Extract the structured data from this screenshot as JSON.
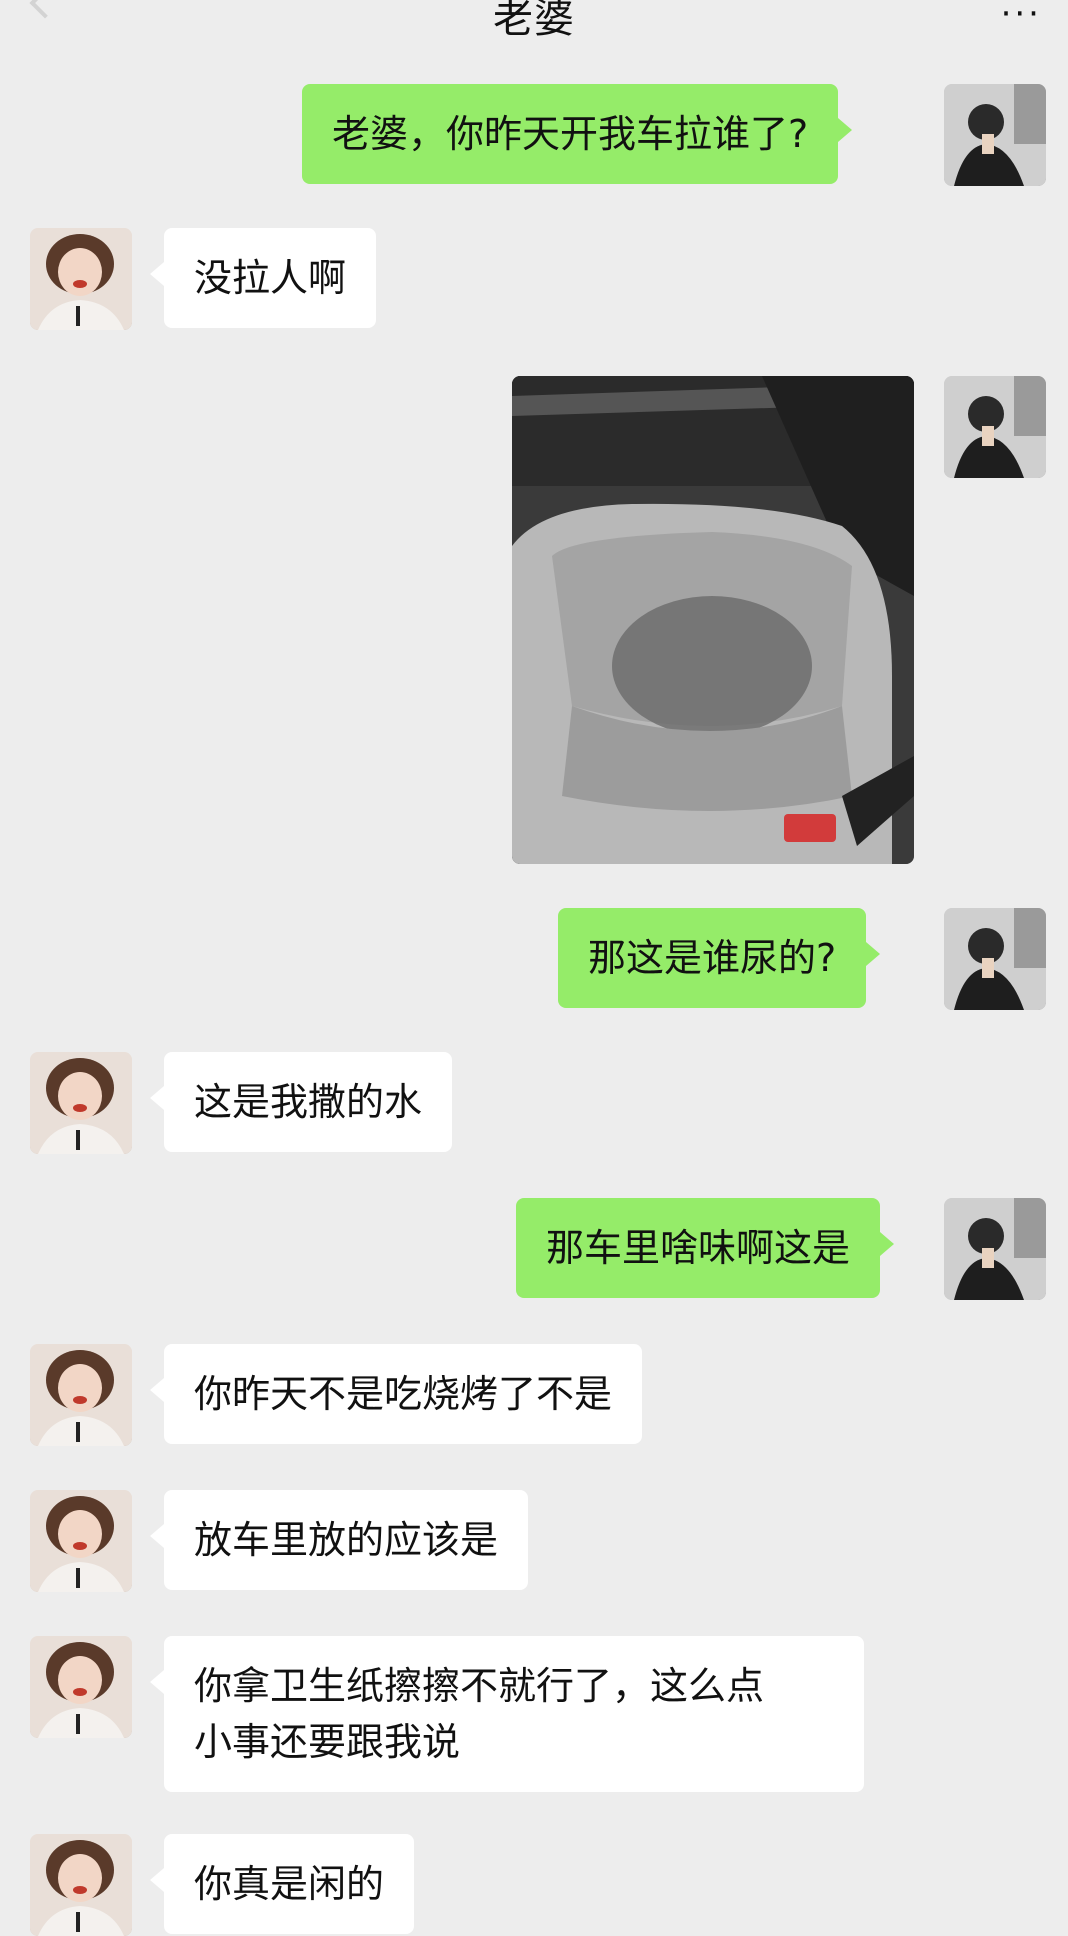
{
  "header": {
    "title": "老婆",
    "more_label": "···"
  },
  "messages": [
    {
      "side": "out",
      "type": "text",
      "text": "老婆，你昨天开我车拉谁了?"
    },
    {
      "side": "in",
      "type": "text",
      "text": "没拉人啊"
    },
    {
      "side": "out",
      "type": "image",
      "description": "car-seat-photo"
    },
    {
      "side": "out",
      "type": "text",
      "text": "那这是谁尿的?"
    },
    {
      "side": "in",
      "type": "text",
      "text": "这是我撒的水"
    },
    {
      "side": "out",
      "type": "text",
      "text": "那车里啥味啊这是"
    },
    {
      "side": "in",
      "type": "text",
      "text": "你昨天不是吃烧烤了不是"
    },
    {
      "side": "in",
      "type": "text",
      "text": "放车里放的应该是"
    },
    {
      "side": "in",
      "type": "text",
      "text": "你拿卫生纸擦擦不就行了，这么点\n小事还要跟我说"
    },
    {
      "side": "in",
      "type": "text",
      "text": "你真是闲的"
    }
  ],
  "colors": {
    "background": "#ededed",
    "outgoing_bubble": "#95ec69",
    "incoming_bubble": "#ffffff"
  }
}
